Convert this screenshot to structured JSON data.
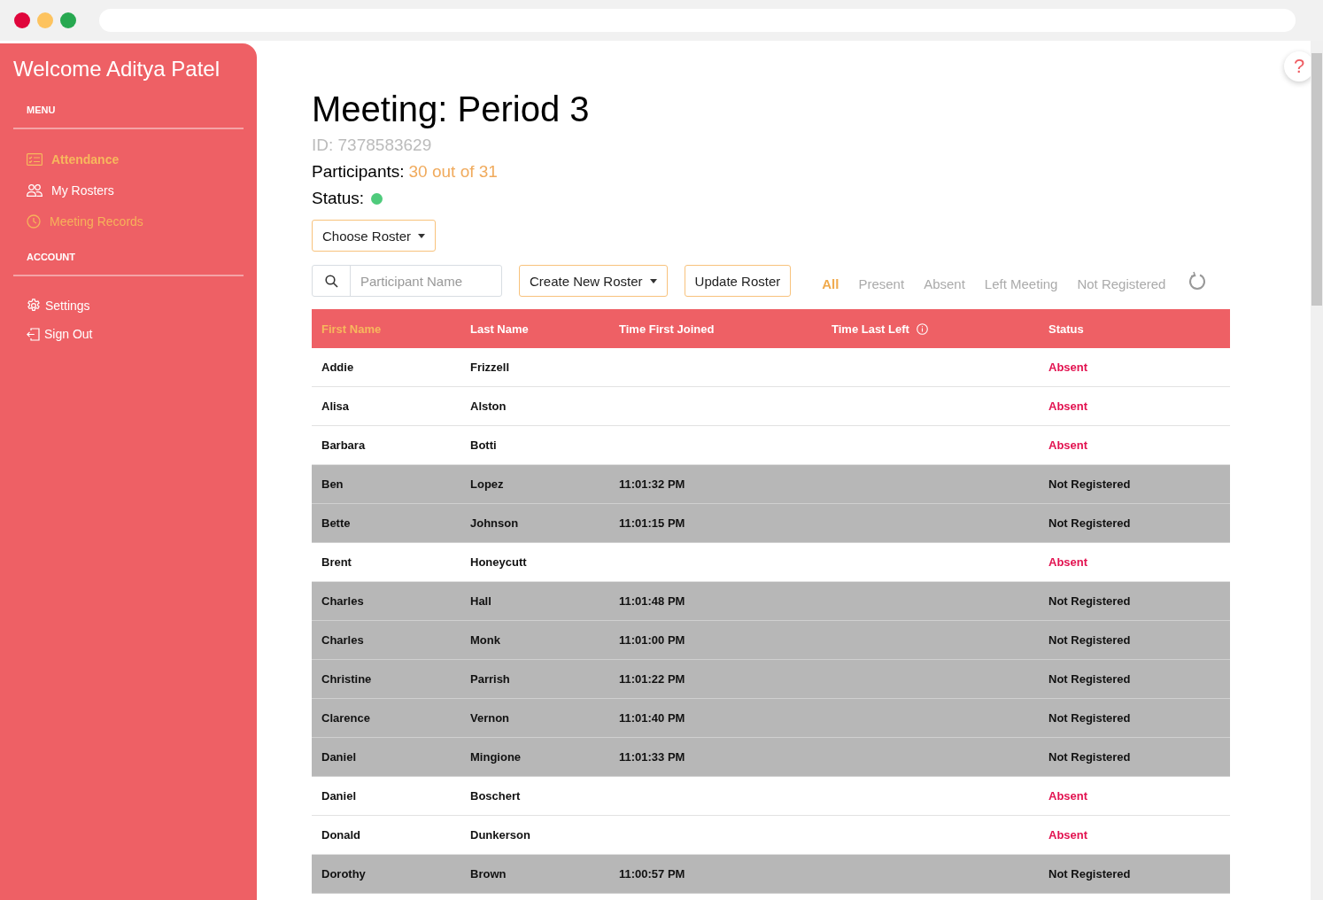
{
  "sidebar": {
    "welcome": "Welcome Aditya Patel",
    "sections": [
      {
        "heading": "MENU",
        "items": [
          {
            "label": "Attendance",
            "kind": "list",
            "selected": true,
            "hovered": false
          },
          {
            "label": "My Rosters",
            "kind": "people",
            "selected": false,
            "hovered": false
          },
          {
            "label": "Meeting Records",
            "kind": "clock",
            "selected": false,
            "hovered": true
          }
        ]
      },
      {
        "heading": "ACCOUNT",
        "items": [
          {
            "label": "Settings",
            "kind": "gear",
            "selected": false,
            "hovered": false
          },
          {
            "label": "Sign Out",
            "kind": "signout",
            "selected": false,
            "hovered": false
          }
        ]
      }
    ]
  },
  "help_button": "?",
  "meeting": {
    "title": "Meeting: Period 3",
    "id": "ID: 7378583629",
    "participants_label": "Participants:",
    "participants_value": "30 out of 31",
    "status_label": "Status:",
    "online": true
  },
  "choose_roster": "Choose Roster",
  "search": {
    "placeholder": "Participant Name"
  },
  "create_roster": "Create New Roster",
  "update_roster": "Update Roster",
  "filters": [
    {
      "label": "All",
      "selected": true
    },
    {
      "label": "Present",
      "selected": false
    },
    {
      "label": "Absent",
      "selected": false
    },
    {
      "label": "Left Meeting",
      "selected": false
    },
    {
      "label": "Not Registered",
      "selected": false
    }
  ],
  "table": {
    "columns": [
      {
        "label": "First Name",
        "selected": true,
        "info": false
      },
      {
        "label": "Last Name",
        "selected": false,
        "info": false
      },
      {
        "label": "Time First Joined",
        "selected": false,
        "info": false
      },
      {
        "label": "Time Last Left",
        "selected": false,
        "info": true
      },
      {
        "label": "Status",
        "selected": false,
        "info": false
      }
    ],
    "rows": [
      {
        "first": "Addie",
        "last": "Frizzell",
        "joined": "",
        "status": "Absent",
        "kind": "absent"
      },
      {
        "first": "Alisa",
        "last": "Alston",
        "joined": "",
        "status": "Absent",
        "kind": "absent"
      },
      {
        "first": "Barbara",
        "last": "Botti",
        "joined": "",
        "status": "Absent",
        "kind": "absent"
      },
      {
        "first": "Ben",
        "last": "Lopez",
        "joined": "11:01:32 PM",
        "status": "Not Registered",
        "kind": "unregistered"
      },
      {
        "first": "Bette",
        "last": "Johnson",
        "joined": "11:01:15 PM",
        "status": "Not Registered",
        "kind": "unregistered"
      },
      {
        "first": "Brent",
        "last": "Honeycutt",
        "joined": "",
        "status": "Absent",
        "kind": "absent"
      },
      {
        "first": "Charles",
        "last": "Hall",
        "joined": "11:01:48 PM",
        "status": "Not Registered",
        "kind": "unregistered"
      },
      {
        "first": "Charles",
        "last": "Monk",
        "joined": "11:01:00 PM",
        "status": "Not Registered",
        "kind": "unregistered"
      },
      {
        "first": "Christine",
        "last": "Parrish",
        "joined": "11:01:22 PM",
        "status": "Not Registered",
        "kind": "unregistered"
      },
      {
        "first": "Clarence",
        "last": "Vernon",
        "joined": "11:01:40 PM",
        "status": "Not Registered",
        "kind": "unregistered"
      },
      {
        "first": "Daniel",
        "last": "Mingione",
        "joined": "11:01:33 PM",
        "status": "Not Registered",
        "kind": "unregistered"
      },
      {
        "first": "Daniel",
        "last": "Boschert",
        "joined": "",
        "status": "Absent",
        "kind": "absent"
      },
      {
        "first": "Donald",
        "last": "Dunkerson",
        "joined": "",
        "status": "Absent",
        "kind": "absent"
      },
      {
        "first": "Dorothy",
        "last": "Brown",
        "joined": "11:00:57 PM",
        "status": "Not Registered",
        "kind": "unregistered"
      }
    ]
  }
}
